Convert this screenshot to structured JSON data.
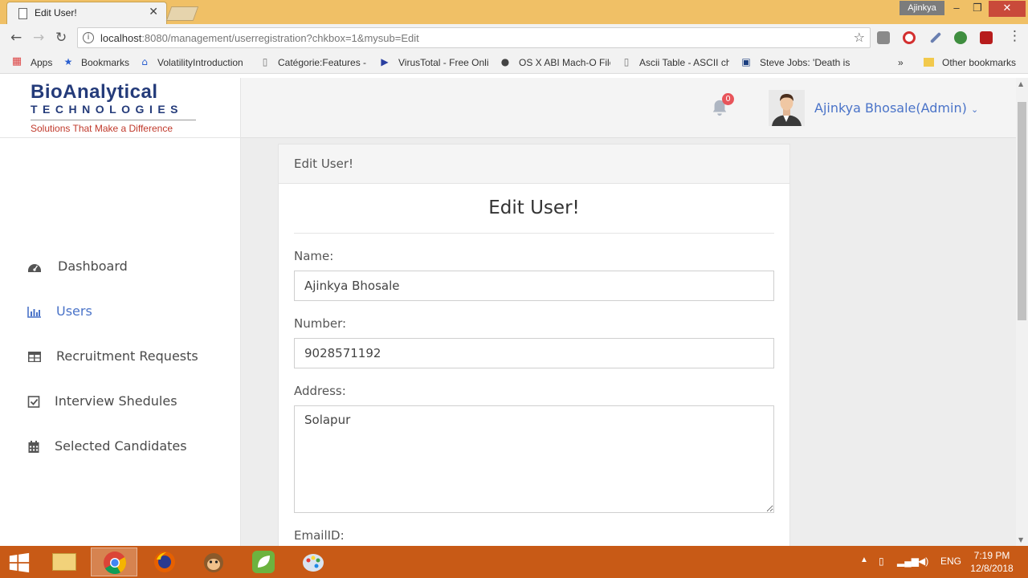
{
  "browser": {
    "tab_title": "Edit User!",
    "profile_name": "Ajinkya",
    "url_host": "localhost",
    "url_rest": ":8080/management/userregistration?chkbox=1&mysub=Edit",
    "bookmarks": [
      {
        "label": "Apps",
        "icon": "apps-grid-icon"
      },
      {
        "label": "Bookmarks",
        "icon": "star-icon"
      },
      {
        "label": "VolatilityIntroduction",
        "icon": "volatility-icon"
      },
      {
        "label": "Catégorie:Features - ",
        "icon": "page-icon"
      },
      {
        "label": "VirusTotal - Free Onli",
        "icon": "virustotal-icon"
      },
      {
        "label": "OS X ABI Mach-O File",
        "icon": "apple-icon"
      },
      {
        "label": "Ascii Table - ASCII ch",
        "icon": "page-icon"
      },
      {
        "label": "Steve Jobs: 'Death is",
        "icon": "site-icon"
      }
    ],
    "more_bookmarks": "»",
    "other_bookmarks": "Other bookmarks"
  },
  "brand": {
    "name": "BioAnalytical",
    "sub": "TECHNOLOGIES",
    "tagline": "Solutions That Make a Difference"
  },
  "header": {
    "notification_count": "0",
    "user_name": "Ajinkya Bhosale(Admin)",
    "accent": "#4a73c8",
    "badge_color": "#e8545a"
  },
  "sidebar": {
    "items": [
      {
        "label": "Dashboard",
        "icon": "dashboard-gauge-icon",
        "active": false
      },
      {
        "label": "Users",
        "icon": "bar-chart-icon",
        "active": true
      },
      {
        "label": "Recruitment Requests",
        "icon": "table-icon",
        "active": false
      },
      {
        "label": "Interview Shedules",
        "icon": "checkbox-icon",
        "active": false
      },
      {
        "label": "Selected Candidates",
        "icon": "calendar-icon",
        "active": false
      }
    ]
  },
  "card": {
    "header": "Edit User!",
    "title": "Edit User!"
  },
  "form": {
    "name_label": "Name:",
    "name_value": "Ajinkya Bhosale",
    "number_label": "Number:",
    "number_value": "9028571192",
    "address_label": "Address:",
    "address_value": "Solapur",
    "email_label": "EmailID:"
  },
  "taskbar": {
    "language": "ENG",
    "time": "7:19 PM",
    "date": "12/8/2018"
  }
}
